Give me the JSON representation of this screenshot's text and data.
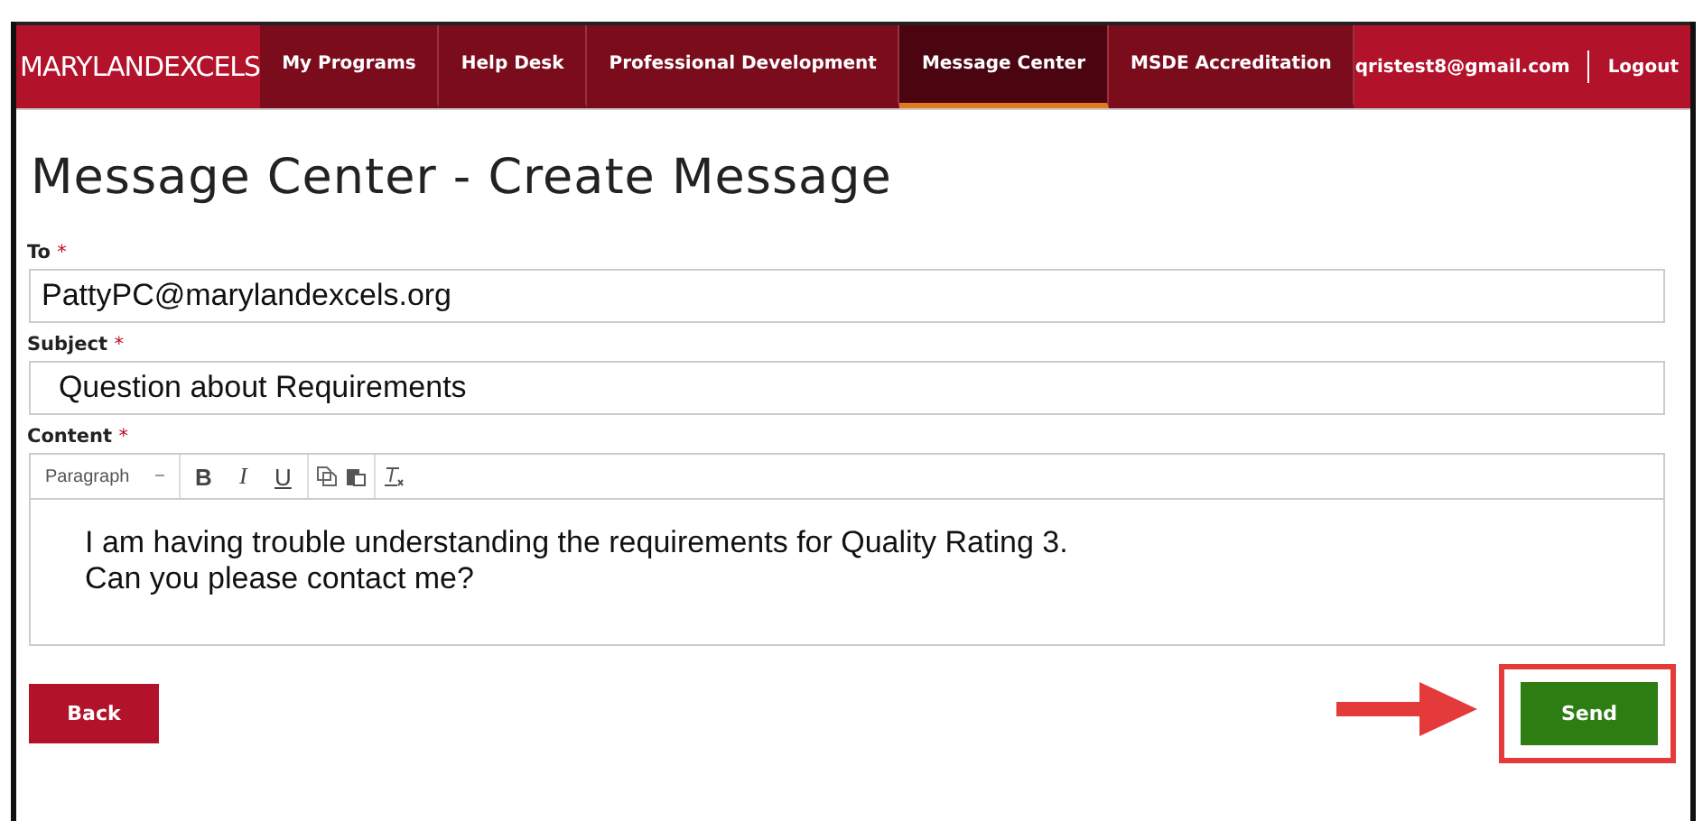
{
  "header": {
    "logo": "MARYLANDEXCELS",
    "nav": [
      {
        "label": "My Programs",
        "selected": false
      },
      {
        "label": "Help Desk",
        "selected": false
      },
      {
        "label": "Professional Development",
        "selected": false
      },
      {
        "label": "Message Center",
        "selected": true
      },
      {
        "label": "MSDE Accreditation",
        "selected": false
      }
    ],
    "user": "qristest8@gmail.com",
    "logout": "Logout"
  },
  "title": "Message Center - Create Message",
  "fields": [
    {
      "label": "To",
      "required_mark": "*",
      "value": "PattyPC@marylandexcels.org"
    },
    {
      "label": "Subject",
      "required_mark": "*",
      "value": "  Question about Requirements"
    }
  ],
  "content": {
    "label": "Content",
    "required_mark": "*",
    "format": "Paragraph",
    "toolbar": [
      {
        "kind": "bold",
        "text": "B"
      },
      {
        "kind": "italic",
        "text": "I"
      },
      {
        "kind": "underline",
        "text": "U"
      },
      {
        "kind": "copy"
      },
      {
        "kind": "paste"
      },
      {
        "kind": "clear"
      }
    ],
    "lines": [
      "I am having trouble understanding the requirements for Quality Rating 3.",
      "Can you please contact me?"
    ]
  },
  "buttons": {
    "back": "Back",
    "send": "Send"
  }
}
